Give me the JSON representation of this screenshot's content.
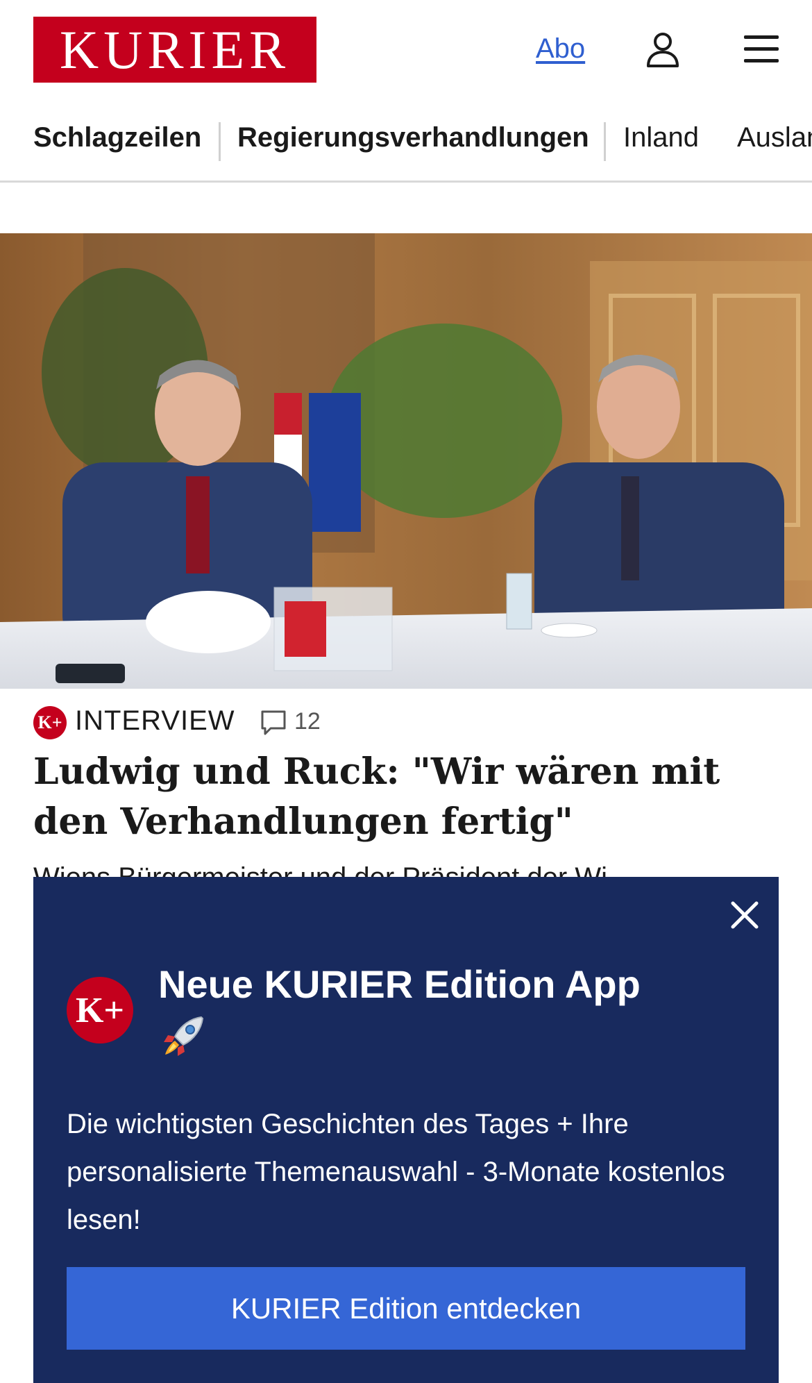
{
  "header": {
    "logo_text": "KURIER",
    "abo_label": "Abo",
    "icons": {
      "user": "user-icon",
      "menu": "menu-icon"
    }
  },
  "nav": {
    "items": [
      {
        "label": "Schlagzeilen"
      },
      {
        "label": "Regierungsverhandlungen"
      },
      {
        "label": "Inland"
      },
      {
        "label": "Ausland"
      }
    ]
  },
  "article": {
    "badge": "K+",
    "category": "INTERVIEW",
    "comment_count": "12",
    "headline": "Ludwig und Ruck: \"Wir wären mit den Verhandlungen fertig\"",
    "teaser_partial": "Wiens Bürgermeister und der Präsident der Wi"
  },
  "popup": {
    "badge": "K+",
    "title": "Neue KURIER Edition App",
    "emoji_icon": "rocket-icon",
    "text": "Die wichtigsten Geschichten des Tages + Ihre personalisierte Themenauswahl - 3-Monate kostenlos lesen!",
    "button_label": "KURIER Edition entdecken",
    "close_icon": "close-icon"
  },
  "colors": {
    "brand_red": "#c4001d",
    "popup_bg": "#182a5e",
    "cta_blue": "#3566d6",
    "link_blue": "#2f5fd0"
  }
}
